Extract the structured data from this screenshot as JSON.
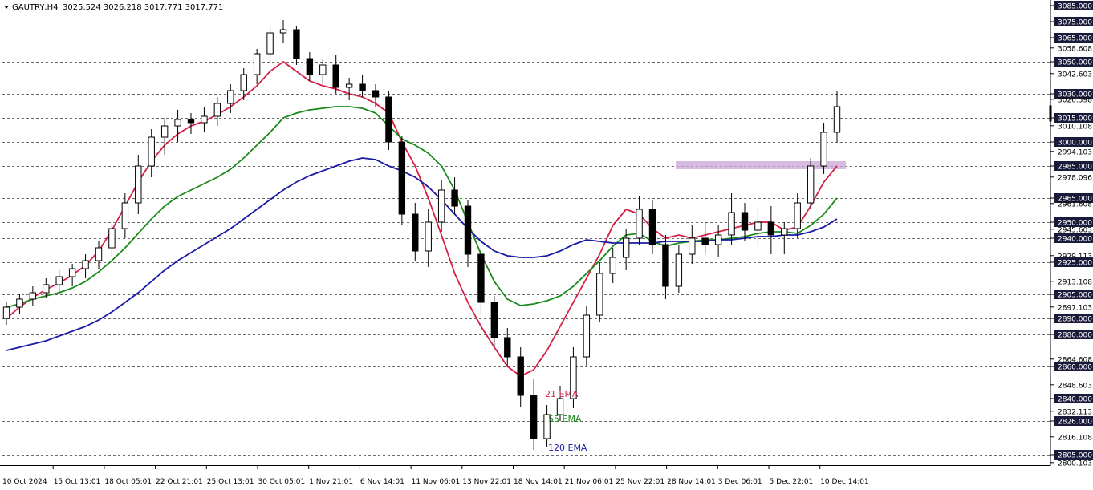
{
  "header": {
    "symbol": "GAUTRY,H4",
    "ohlc": "3025.524 3026.218 3017.771 3017.771"
  },
  "chart_data": {
    "type": "candlestick",
    "title": "GAUTRY,H4  3025.524 3026.218 3017.771 3017.771",
    "y_axis": {
      "range": [
        2800,
        3086
      ],
      "ticks": [
        "3085.000",
        "3075.000",
        "3065.000",
        "3058.608",
        "3050.000",
        "3042.603",
        "3030.000",
        "3026.598",
        "3015.000",
        "3010.108",
        "3000.000",
        "2994.103",
        "2985.000",
        "2978.096",
        "2965.000",
        "2961.608",
        "2950.000",
        "2945.603",
        "2940.000",
        "2929.113",
        "2925.000",
        "2913.108",
        "2905.000",
        "2897.103",
        "2890.000",
        "2880.000",
        "2864.608",
        "2860.000",
        "2848.603",
        "2840.000",
        "2832.113",
        "2826.000",
        "2816.108",
        "2805.000",
        "2800.103"
      ]
    },
    "x_axis": {
      "ticks": [
        "10 Oct 2024",
        "15 Oct 13:01",
        "18 Oct 05:01",
        "22 Oct 21:01",
        "25 Oct 13:01",
        "30 Oct 05:01",
        "1 Nov 21:01",
        "6 Nov 14:01",
        "11 Nov 06:01",
        "13 Nov 22:01",
        "18 Nov 14:01",
        "21 Nov 06:01",
        "25 Nov 22:01",
        "28 Nov 14:01",
        "3 Dec 06:01",
        "5 Dec 22:01",
        "10 Dec 14:01"
      ]
    },
    "horizontal_levels": [
      3085,
      3075,
      3065,
      3050,
      3030,
      3015,
      3000,
      2985,
      2965,
      2950,
      2940,
      2925,
      2905,
      2890,
      2880,
      2860,
      2840,
      2826,
      2805
    ],
    "zone": {
      "from": 2983,
      "to": 2988
    },
    "current_price": 3017.771,
    "grid": false,
    "ema_keys": [
      {
        "name": "21 EMA",
        "color": "#d61f44"
      },
      {
        "name": "55 EMA",
        "color": "#1a8a1a"
      },
      {
        "name": "120 EMA",
        "color": "#1a1aa6"
      }
    ],
    "series": [
      {
        "name": "21 EMA",
        "values": [
          2890,
          2897,
          2903,
          2908,
          2912,
          2917,
          2923,
          2932,
          2945,
          2960,
          2975,
          2988,
          2998,
          3005,
          3010,
          3013,
          3017,
          3022,
          3028,
          3035,
          3044,
          3050,
          3044,
          3038,
          3035,
          3033,
          3030,
          3028,
          3024,
          3018,
          3000,
          2985,
          2965,
          2942,
          2918,
          2900,
          2885,
          2872,
          2860,
          2854,
          2858,
          2870,
          2885,
          2900,
          2915,
          2930,
          2948,
          2958,
          2955,
          2946,
          2940,
          2942,
          2940,
          2942,
          2944,
          2946,
          2948,
          2950,
          2950,
          2945,
          2947,
          2960,
          2975,
          2985
        ]
      },
      {
        "name": "55 EMA",
        "values": [
          2897,
          2899,
          2902,
          2904,
          2906,
          2909,
          2913,
          2919,
          2926,
          2934,
          2943,
          2952,
          2960,
          2966,
          2970,
          2974,
          2978,
          2983,
          2990,
          2998,
          3006,
          3015,
          3018,
          3020,
          3021,
          3022,
          3022,
          3021,
          3018,
          3010,
          3002,
          2998,
          2993,
          2985,
          2970,
          2950,
          2930,
          2913,
          2902,
          2898,
          2899,
          2901,
          2904,
          2910,
          2918,
          2926,
          2935,
          2942,
          2943,
          2938,
          2935,
          2937,
          2938,
          2939,
          2939,
          2940,
          2941,
          2943,
          2944,
          2944,
          2943,
          2948,
          2955,
          2965
        ]
      },
      {
        "name": "120 EMA",
        "values": [
          2870,
          2872,
          2874,
          2876,
          2879,
          2882,
          2885,
          2889,
          2894,
          2900,
          2906,
          2913,
          2920,
          2926,
          2931,
          2936,
          2941,
          2946,
          2952,
          2958,
          2964,
          2970,
          2975,
          2979,
          2982,
          2985,
          2988,
          2990,
          2989,
          2985,
          2982,
          2978,
          2972,
          2964,
          2955,
          2946,
          2938,
          2932,
          2929,
          2928,
          2928,
          2929,
          2932,
          2936,
          2939,
          2938,
          2937,
          2937,
          2937,
          2937,
          2938,
          2938,
          2938,
          2938,
          2939,
          2939,
          2940,
          2941,
          2941,
          2942,
          2942,
          2944,
          2947,
          2952
        ]
      }
    ],
    "candles": [
      [
        2890,
        2900,
        2886,
        2897
      ],
      [
        2897,
        2905,
        2893,
        2902
      ],
      [
        2902,
        2910,
        2898,
        2906
      ],
      [
        2906,
        2915,
        2903,
        2911
      ],
      [
        2911,
        2920,
        2906,
        2916
      ],
      [
        2916,
        2924,
        2910,
        2921
      ],
      [
        2921,
        2930,
        2915,
        2926
      ],
      [
        2926,
        2938,
        2921,
        2934
      ],
      [
        2934,
        2950,
        2928,
        2946
      ],
      [
        2946,
        2968,
        2940,
        2962
      ],
      [
        2962,
        2992,
        2955,
        2985
      ],
      [
        2985,
        3008,
        2978,
        3003
      ],
      [
        3003,
        3015,
        2992,
        3010
      ],
      [
        3010,
        3020,
        3000,
        3014
      ],
      [
        3014,
        3018,
        3005,
        3012
      ],
      [
        3012,
        3022,
        3006,
        3016
      ],
      [
        3016,
        3028,
        3010,
        3024
      ],
      [
        3024,
        3036,
        3018,
        3032
      ],
      [
        3032,
        3046,
        3026,
        3042
      ],
      [
        3042,
        3058,
        3036,
        3055
      ],
      [
        3055,
        3072,
        3050,
        3068
      ],
      [
        3068,
        3076,
        3062,
        3070
      ],
      [
        3070,
        3072,
        3048,
        3052
      ],
      [
        3052,
        3056,
        3038,
        3042
      ],
      [
        3042,
        3052,
        3036,
        3048
      ],
      [
        3048,
        3054,
        3030,
        3034
      ],
      [
        3034,
        3040,
        3026,
        3036
      ],
      [
        3036,
        3042,
        3028,
        3032
      ],
      [
        3032,
        3036,
        3022,
        3028
      ],
      [
        3028,
        3032,
        2995,
        3000
      ],
      [
        3000,
        3004,
        2948,
        2955
      ],
      [
        2955,
        2962,
        2926,
        2932
      ],
      [
        2932,
        2958,
        2922,
        2950
      ],
      [
        2950,
        2976,
        2944,
        2970
      ],
      [
        2970,
        2978,
        2955,
        2960
      ],
      [
        2960,
        2964,
        2922,
        2930
      ],
      [
        2930,
        2934,
        2892,
        2900
      ],
      [
        2900,
        2904,
        2872,
        2878
      ],
      [
        2878,
        2884,
        2860,
        2866
      ],
      [
        2866,
        2872,
        2835,
        2842
      ],
      [
        2842,
        2852,
        2808,
        2815
      ],
      [
        2815,
        2836,
        2810,
        2830
      ],
      [
        2830,
        2848,
        2826,
        2840
      ],
      [
        2840,
        2872,
        2834,
        2866
      ],
      [
        2866,
        2898,
        2860,
        2892
      ],
      [
        2892,
        2925,
        2888,
        2918
      ],
      [
        2918,
        2934,
        2912,
        2928
      ],
      [
        2928,
        2946,
        2920,
        2940
      ],
      [
        2940,
        2966,
        2936,
        2958
      ],
      [
        2958,
        2964,
        2930,
        2936
      ],
      [
        2936,
        2942,
        2902,
        2910
      ],
      [
        2910,
        2936,
        2906,
        2930
      ],
      [
        2930,
        2948,
        2924,
        2940
      ],
      [
        2940,
        2950,
        2930,
        2936
      ],
      [
        2936,
        2948,
        2928,
        2942
      ],
      [
        2942,
        2968,
        2936,
        2956
      ],
      [
        2956,
        2962,
        2938,
        2945
      ],
      [
        2945,
        2958,
        2935,
        2950
      ],
      [
        2950,
        2960,
        2930,
        2942
      ],
      [
        2942,
        2950,
        2930,
        2946
      ],
      [
        2946,
        2968,
        2940,
        2962
      ],
      [
        2962,
        2990,
        2958,
        2985
      ],
      [
        2985,
        3012,
        2980,
        3006
      ],
      [
        3006,
        3032,
        3000,
        3022
      ]
    ]
  }
}
